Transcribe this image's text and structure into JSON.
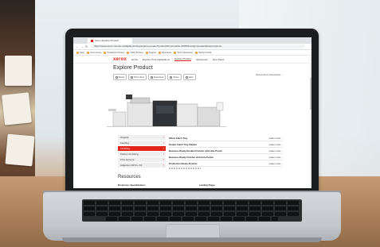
{
  "browser": {
    "tab_title": "Xerox Explore Product",
    "url": "https://www.xerox.com/en-us/digital-printing/explore-product?productID=primelink-c9065&config=standard&view=options"
  },
  "bookmarks": [
    "Apps",
    "Xerox Home",
    "Production Printers",
    "Office Printers",
    "Support",
    "Resources",
    "Xerox Newsroom",
    "Partner Portal",
    "More"
  ],
  "site": {
    "logo": "xerox",
    "nav": [
      "Home",
      "Explore Print Applications",
      "Explore Product",
      "Resources",
      "Next Steps"
    ],
    "active_nav_index": 2
  },
  "page": {
    "title": "Explore Product",
    "toolbar": [
      "Reset",
      "Print View",
      "Download",
      "Share",
      "Help"
    ],
    "dimensions_link": "View product dimensions"
  },
  "side_menu": {
    "items": [
      "Original",
      "Feeding",
      "Finishing",
      "Partner Finishing",
      "Print Servers",
      "Adaptive CMYK+ Kit"
    ],
    "active_index": 2
  },
  "options": [
    {
      "name": "Offset Catch Tray",
      "link": "Learn more"
    },
    {
      "name": "Output Catch Tray Stacker",
      "link": "Learn more"
    },
    {
      "name": "Business Ready Booklet Finisher with Hole Punch",
      "link": "Learn more"
    },
    {
      "name": "Business Ready Finisher with Hole Punch",
      "link": "Learn more"
    },
    {
      "name": "Production Ready Finisher",
      "link": "Learn more"
    }
  ],
  "resources": {
    "title": "Resources",
    "col1": "Brochures, Specifications",
    "col2": "Landing Pages"
  },
  "colors": {
    "brand_red": "#e1251b"
  }
}
